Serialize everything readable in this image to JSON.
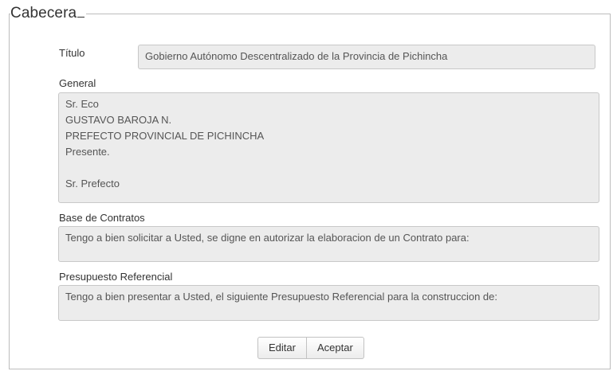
{
  "form": {
    "legend": "Cabecera",
    "titulo": {
      "label": "Título",
      "value": "Gobierno Autónomo Descentralizado de la Provincia de Pichincha"
    },
    "general": {
      "label": "General",
      "value": "Sr. Eco\nGUSTAVO BAROJA N.\nPREFECTO PROVINCIAL DE PICHINCHA\nPresente.\n\nSr. Prefecto"
    },
    "base_contratos": {
      "label": "Base de Contratos",
      "value": "Tengo a bien solicitar a Usted, se digne en autorizar la elaboracion de un Contrato para:"
    },
    "presupuesto": {
      "label": "Presupuesto Referencial",
      "value": "Tengo a bien presentar a Usted, el siguiente Presupuesto Referencial para la construccion de:"
    }
  },
  "buttons": {
    "editar": "Editar",
    "aceptar": "Aceptar"
  }
}
